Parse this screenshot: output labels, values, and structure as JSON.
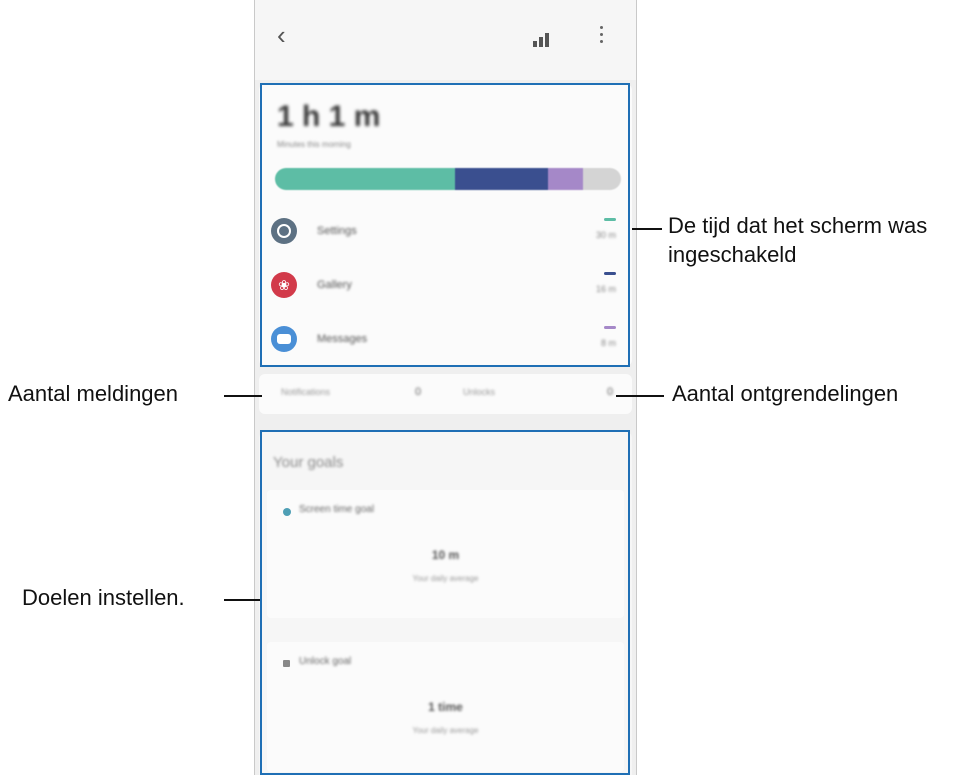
{
  "colors": {
    "highlight": "#1f6fb5",
    "bar_teal": "#5dbda5",
    "bar_navy": "#3a4f8f",
    "bar_purple": "#a588c8",
    "bar_grey": "#d4d4d4",
    "settings_icon": "#5d7183",
    "gallery_icon": "#d23a4a",
    "messages_icon": "#4a8fd6"
  },
  "header": {
    "back_icon": "chevron-left-icon",
    "chart_icon": "bar-chart-icon",
    "more_icon": "more-vertical-icon"
  },
  "screen_time": {
    "total": "1 h 1 m",
    "caption": "Minutes this morning",
    "usage_bar": [
      0.52,
      0.27,
      0.1,
      0.11
    ],
    "apps": [
      {
        "name": "Settings",
        "time": "30 m",
        "icon": "settings-icon"
      },
      {
        "name": "Gallery",
        "time": "16 m",
        "icon": "gallery-icon"
      },
      {
        "name": "Messages",
        "time": "8 m",
        "icon": "messages-icon"
      }
    ]
  },
  "stats": {
    "notifications_label": "Notifications",
    "notifications_value": "0",
    "unlocks_label": "Unlocks",
    "unlocks_value": "0"
  },
  "goals": {
    "title": "Your goals",
    "screen_time_goal": {
      "label": "Screen time goal",
      "value": "10 m",
      "sub": "Your daily average"
    },
    "unlock_goal": {
      "label": "Unlock goal",
      "value": "1 time",
      "sub": "Your daily average"
    }
  },
  "callouts": {
    "screen_on_time": "De tijd dat het scherm was ingeschakeld",
    "notifications": "Aantal meldingen",
    "unlocks": "Aantal ontgrendelingen",
    "goals": "Doelen instellen."
  }
}
